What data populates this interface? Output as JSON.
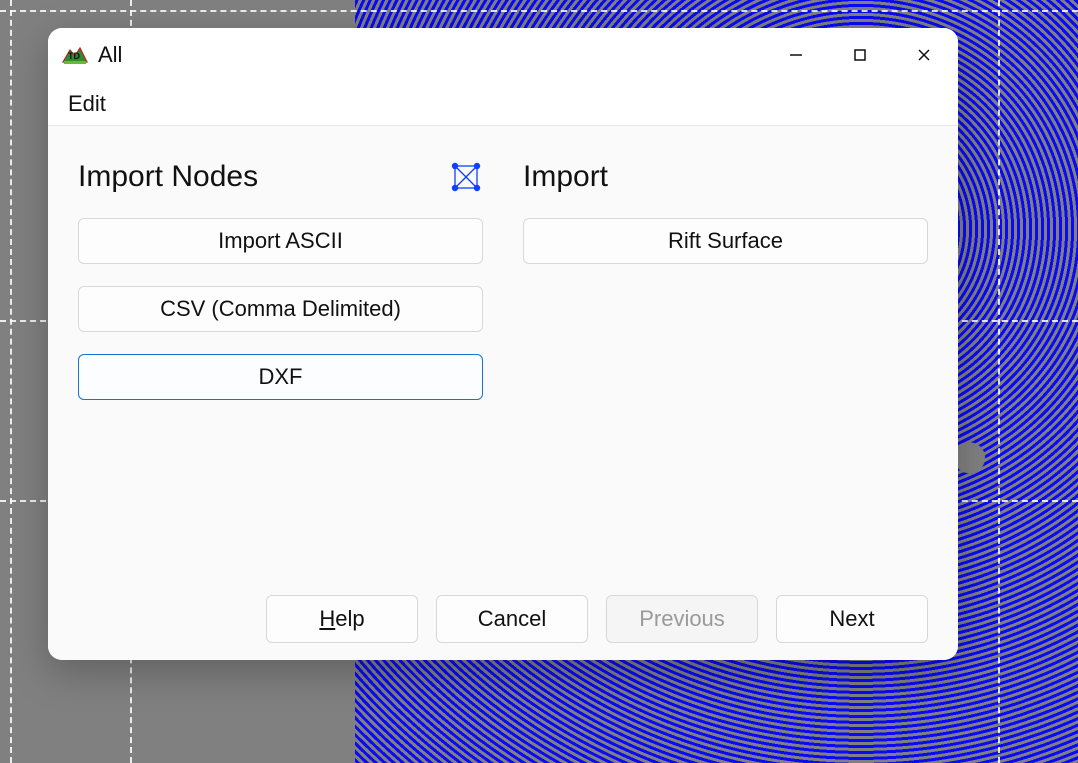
{
  "window": {
    "title": "All",
    "menu": {
      "edit": "Edit"
    }
  },
  "left": {
    "heading": "Import Nodes",
    "buttons": {
      "ascii": "Import ASCII",
      "csv": "CSV (Comma Delimited)",
      "dxf": "DXF"
    }
  },
  "right": {
    "heading": "Import",
    "buttons": {
      "rift": "Rift Surface"
    }
  },
  "footer": {
    "help": "Help",
    "cancel": "Cancel",
    "previous": "Previous",
    "next": "Next"
  }
}
